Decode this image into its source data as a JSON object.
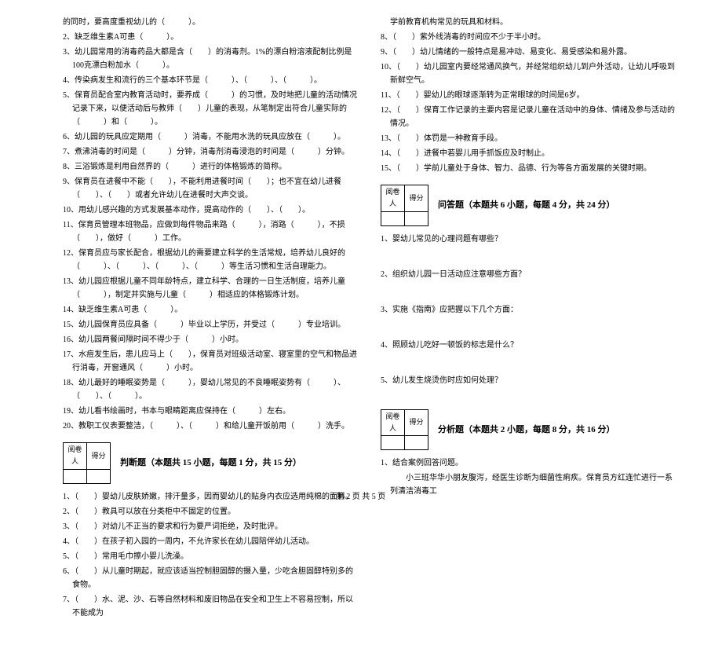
{
  "footer": "第 2 页 共 5 页",
  "score_header": {
    "c1": "阅卷人",
    "c2": "得分"
  },
  "left": {
    "fill": [
      "的同时，要高度重视幼儿的（　　　）。",
      "2、缺乏维生素A可患（　　　）。",
      "3、幼儿园常用的消毒药品大都是含（　　）的消毒剂。1%的漂白粉溶液配制比例是100克漂白粉加水（　　　）。",
      "4、传染病发生和流行的三个基本环节是（　　　）、（　　　）、（　　　）。",
      "5、保育员配合室内教育活动时，要养成（　　　）的习惯，及时地把儿童的活动情况记录下来，以便活动后与教师（　　）儿童的表现，从笔制定出符合儿童实际的（　　　）和（　　　）。",
      "6、幼儿园的玩具应定期用（　　　）消毒，不能用水洗的玩具应放在（　　　）。",
      "7、煮沸消毒的时间是（　　　）分钟，消毒剂消毒浸泡的时间是（　　　）分钟。",
      "8、三浴锻炼是利用自然界的（　　　）进行的体格锻炼的简称。",
      "9、保育员在进餐中不能（　　），不能利用进餐时间（　　）；也不宜在幼儿进餐（　　）、（　　）或者允许幼儿在进餐时大声交谈。",
      "10、用幼儿感兴趣的方式发展基本动作，提高动作的（　　）、（　　）。",
      "11、保育员管理本班物品，应做到每件物品来路（　　　），消路（　　　），不损（　　），做好（　　　）工作。",
      "12、保育员应与家长配合，根据幼儿的需要建立科学的生活常规，培养幼儿良好的（　　　）、（　　　）、（　　　）、（　　　）等生活习惯和生活自理能力。",
      "13、幼儿园应根据儿童不同年龄特点，建立科学、合理的一日生活制度，培养儿童（　　　），制定并实施与儿童（　　　）相适应的体格锻炼计划。",
      "14、缺乏维生素A可患（　　　）。",
      "15、幼儿园保育员应具备（　　　）毕业以上学历，并受过（　　　）专业培训。",
      "16、幼儿园两餐间隔时间不得少于（　　　）小时。",
      "17、水痘发生后，患儿应马上（　　），保育员对班级活动室、寝室里的空气和物品进行消毒，开窗通风（　　　）小时。",
      "18、幼儿最好的睡眠姿势是（　　　），婴幼儿常见的不良睡眠姿势有（　　　）、（　　）、（　　　）。",
      "19、幼儿看书绘画时，书本与眼睛距离应保持在（　　　）左右。",
      "20、教职工仪表要整洁，（　　　）、（　　　）和给儿童开饭前用（　　　）洗手。"
    ],
    "judge_title": "判断题（本题共 15 小题，每题 1 分，共 15 分）",
    "judge": [
      "1、（　　）婴幼儿皮肤娇嫩，排汗量多，因而婴幼儿的贴身内衣应选用纯棉的面料。",
      "2、（　　）教具可以放在分类柜中不固定的位置。",
      "3、（　　）对幼儿不正当的要求和行为要严词拒绝，及时批评。",
      "4、（　　）在孩子初入园的一周内，不允许家长在幼儿园陪伴幼儿活动。",
      "5、（　　）常用毛巾擦小婴儿洗澡。",
      "6、（　　）从儿童时期起，就应该适当控制胆固醇的摄入量，少吃含胆固醇特别多的食物。",
      "7、（　　）水、泥、沙、石等自然材料和废旧物品在安全和卫生上不容易控制，所以不能成为"
    ]
  },
  "right": {
    "judge_cont": [
      "学前教育机构常见的玩具和材料。",
      "8、（　　）紫外线消毒的时间应不少于半小时。",
      "9、（　　）幼儿情绪的一般特点是易冲动、易变化、易受感染和易外露。",
      "10、（　　）幼儿园室内要经常通风换气，并经常组织幼儿到户外活动，让幼儿呼吸到新鲜空气。",
      "11、（　　）婴幼儿的眼球逐渐转为正常眼球的时间是6岁。",
      "12、（　　）保育工作记录的主要内容是记录儿童在活动中的身体、情绪及参与活动的情况。",
      "13、（　　）体罚是一种教育手段。",
      "14、（　　）进餐中若婴儿用手抓饭应及时制止。",
      "15、（　　）学前儿童处于身体、智力、品德、行为等各方面发展的关键时期。"
    ],
    "qa_title": "问答题（本题共 6 小题，每题 4 分，共 24 分）",
    "qa": [
      "1、婴幼儿常见的心理问题有哪些？",
      "2、组织幼儿园一日活动应注意哪些方面？",
      "3、实施《指南》应把握以下几个方面：",
      "4、照顾幼儿吃好一顿饭的标志是什么？",
      "5、幼儿发生烧烫伤时应如何处理？"
    ],
    "analysis_title": "分析题（本题共 2 小题，每题 8 分，共 16 分）",
    "analysis": [
      "1、结合案例回答问题。",
      "　　小三班华华小朋友腹泻，经医生诊断为细菌性痢疾。保育员方红连忙进行一系列清洁消毒工"
    ]
  }
}
